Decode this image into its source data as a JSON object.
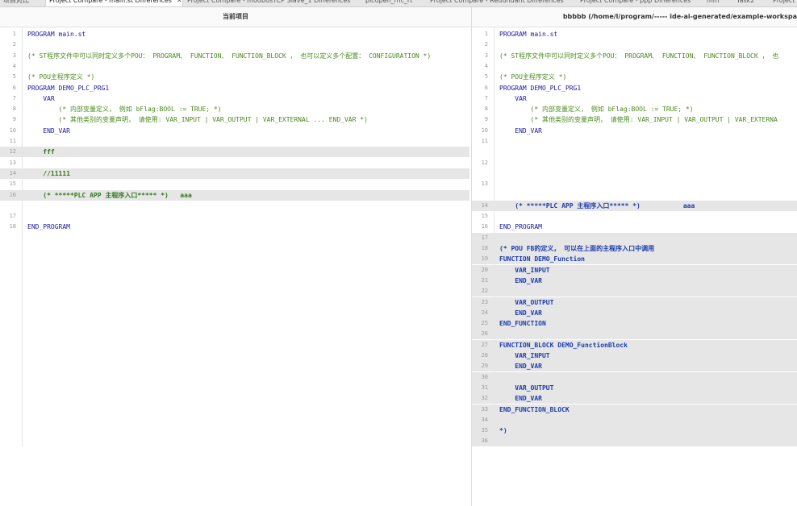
{
  "tabs": [
    {
      "label": "项目对比",
      "active": false
    },
    {
      "label": "Project Compare - main.st Differences",
      "active": true
    },
    {
      "label": "Project Compare - modbusTCP Slave_1 Differences",
      "active": false
    },
    {
      "label": "plcopen_mc_rt",
      "active": false
    },
    {
      "label": "Project Compare - Redundant Differences",
      "active": false
    },
    {
      "label": "Project Compare - ppp Differences",
      "active": false
    },
    {
      "label": "mm",
      "active": false
    },
    {
      "label": "Task2",
      "active": false
    },
    {
      "label": "Project",
      "active": false
    }
  ],
  "left": {
    "title": "当前项目",
    "lines": [
      {
        "n": "1",
        "t": "PROGRAM main.st",
        "s": "rd"
      },
      {
        "n": "2",
        "t": "",
        "s": ""
      },
      {
        "n": "3",
        "t": "(* ST程序文件中可以同时定义多个POU： PROGRAM、 FUNCTION、 FUNCTION_BLOCK ， 也可以定义多个配置： CONFIGURATION *)",
        "s": "cm"
      },
      {
        "n": "4",
        "t": "",
        "s": ""
      },
      {
        "n": "5",
        "t": "(* POU主程序定义 *)",
        "s": "cm"
      },
      {
        "n": "6",
        "t": "PROGRAM DEMO_PLC_PRG1",
        "s": "rd"
      },
      {
        "n": "7",
        "t": "    VAR",
        "s": ""
      },
      {
        "n": "8",
        "t": "        (* 内部变量定义， 例如 bFlag:BOOL := TRUE; *)",
        "s": "cm"
      },
      {
        "n": "9",
        "t": "        (* 其他类别的变量声明， 请使用: VAR_INPUT | VAR_OUTPUT | VAR_EXTERNAL ... END_VAR *)",
        "s": "cm"
      },
      {
        "n": "10",
        "t": "    END_VAR",
        "s": ""
      },
      {
        "n": "11",
        "t": "",
        "s": ""
      },
      {
        "n": "12",
        "t": "    fff",
        "s": "gr",
        "hl": true
      },
      {
        "n": "13",
        "t": "",
        "s": ""
      },
      {
        "n": "14",
        "t": "    //11111",
        "s": "gr",
        "hl": true
      },
      {
        "n": "15",
        "t": "",
        "s": ""
      },
      {
        "n": "16",
        "t": "    (* *****PLC APP 主程序入口***** *)   aaa",
        "s": "gr",
        "hl": true
      },
      {
        "n": "",
        "t": "",
        "s": ""
      },
      {
        "n": "17",
        "t": "",
        "s": ""
      },
      {
        "n": "18",
        "t": "END_PROGRAM",
        "s": ""
      }
    ]
  },
  "right": {
    "title": "bbbbb (/home/l/program/----- ide-ai-generated/example-workspa",
    "lines": [
      {
        "n": "1",
        "t": "PROGRAM main.st",
        "s": "rd"
      },
      {
        "n": "2",
        "t": "",
        "s": ""
      },
      {
        "n": "3",
        "t": "(* ST程序文件中可以同时定义多个POU： PROGRAM、 FUNCTION、 FUNCTION_BLOCK ， 也",
        "s": "cm"
      },
      {
        "n": "4",
        "t": "",
        "s": ""
      },
      {
        "n": "5",
        "t": "(* POU主程序定义 *)",
        "s": "cm"
      },
      {
        "n": "6",
        "t": "PROGRAM DEMO_PLC_PRG1",
        "s": "rd"
      },
      {
        "n": "7",
        "t": "    VAR",
        "s": ""
      },
      {
        "n": "8",
        "t": "        (* 内部变量定义， 例如 bFlag:BOOL := TRUE; *)",
        "s": "cm"
      },
      {
        "n": "9",
        "t": "        (* 其他类别的变量声明， 请使用: VAR_INPUT | VAR_OUTPUT | VAR_EXTERNA",
        "s": "cm"
      },
      {
        "n": "10",
        "t": "    END_VAR",
        "s": ""
      },
      {
        "n": "11",
        "t": "",
        "s": ""
      },
      {
        "n": "",
        "t": "",
        "s": ""
      },
      {
        "n": "12",
        "t": "",
        "s": ""
      },
      {
        "n": "",
        "t": "",
        "s": ""
      },
      {
        "n": "13",
        "t": "",
        "s": ""
      },
      {
        "n": "",
        "t": "",
        "s": ""
      },
      {
        "n": "14",
        "t": "    (* *****PLC APP 主程序入口***** *)           aaa",
        "s": "bl",
        "hl": true
      },
      {
        "n": "15",
        "t": "",
        "s": ""
      },
      {
        "n": "16",
        "t": "END_PROGRAM",
        "s": ""
      },
      {
        "n": "17",
        "t": "",
        "s": "",
        "hl": true
      },
      {
        "n": "18",
        "t": "(* POU FB的定义， 可以在上面的主程序入口中调用",
        "s": "bl",
        "hl": true
      },
      {
        "n": "19",
        "t": "FUNCTION DEMO_Function",
        "s": "bl",
        "hl": true
      },
      {
        "n": "20",
        "t": "    VAR_INPUT",
        "s": "bl",
        "hl": true
      },
      {
        "n": "21",
        "t": "    END_VAR",
        "s": "bl",
        "hl": true
      },
      {
        "n": "22",
        "t": "",
        "s": "",
        "hl": true
      },
      {
        "n": "23",
        "t": "    VAR_OUTPUT",
        "s": "bl",
        "hl": true
      },
      {
        "n": "24",
        "t": "    END_VAR",
        "s": "bl",
        "hl": true
      },
      {
        "n": "25",
        "t": "END_FUNCTION",
        "s": "bl",
        "hl": true
      },
      {
        "n": "26",
        "t": "",
        "s": "",
        "hl": true
      },
      {
        "n": "27",
        "t": "FUNCTION_BLOCK DEMO_FunctionBlock",
        "s": "bl",
        "hl": true
      },
      {
        "n": "28",
        "t": "    VAR_INPUT",
        "s": "bl",
        "hl": true
      },
      {
        "n": "29",
        "t": "    END_VAR",
        "s": "bl",
        "hl": true
      },
      {
        "n": "30",
        "t": "",
        "s": "",
        "hl": true
      },
      {
        "n": "31",
        "t": "    VAR_OUTPUT",
        "s": "bl",
        "hl": true
      },
      {
        "n": "32",
        "t": "    END_VAR",
        "s": "bl",
        "hl": true
      },
      {
        "n": "33",
        "t": "END_FUNCTION_BLOCK",
        "s": "bl",
        "hl": true
      },
      {
        "n": "34",
        "t": "",
        "s": "",
        "hl": true
      },
      {
        "n": "35",
        "t": "*)",
        "s": "bl",
        "hl": true
      },
      {
        "n": "36",
        "t": "",
        "s": "",
        "hl": true
      }
    ]
  }
}
